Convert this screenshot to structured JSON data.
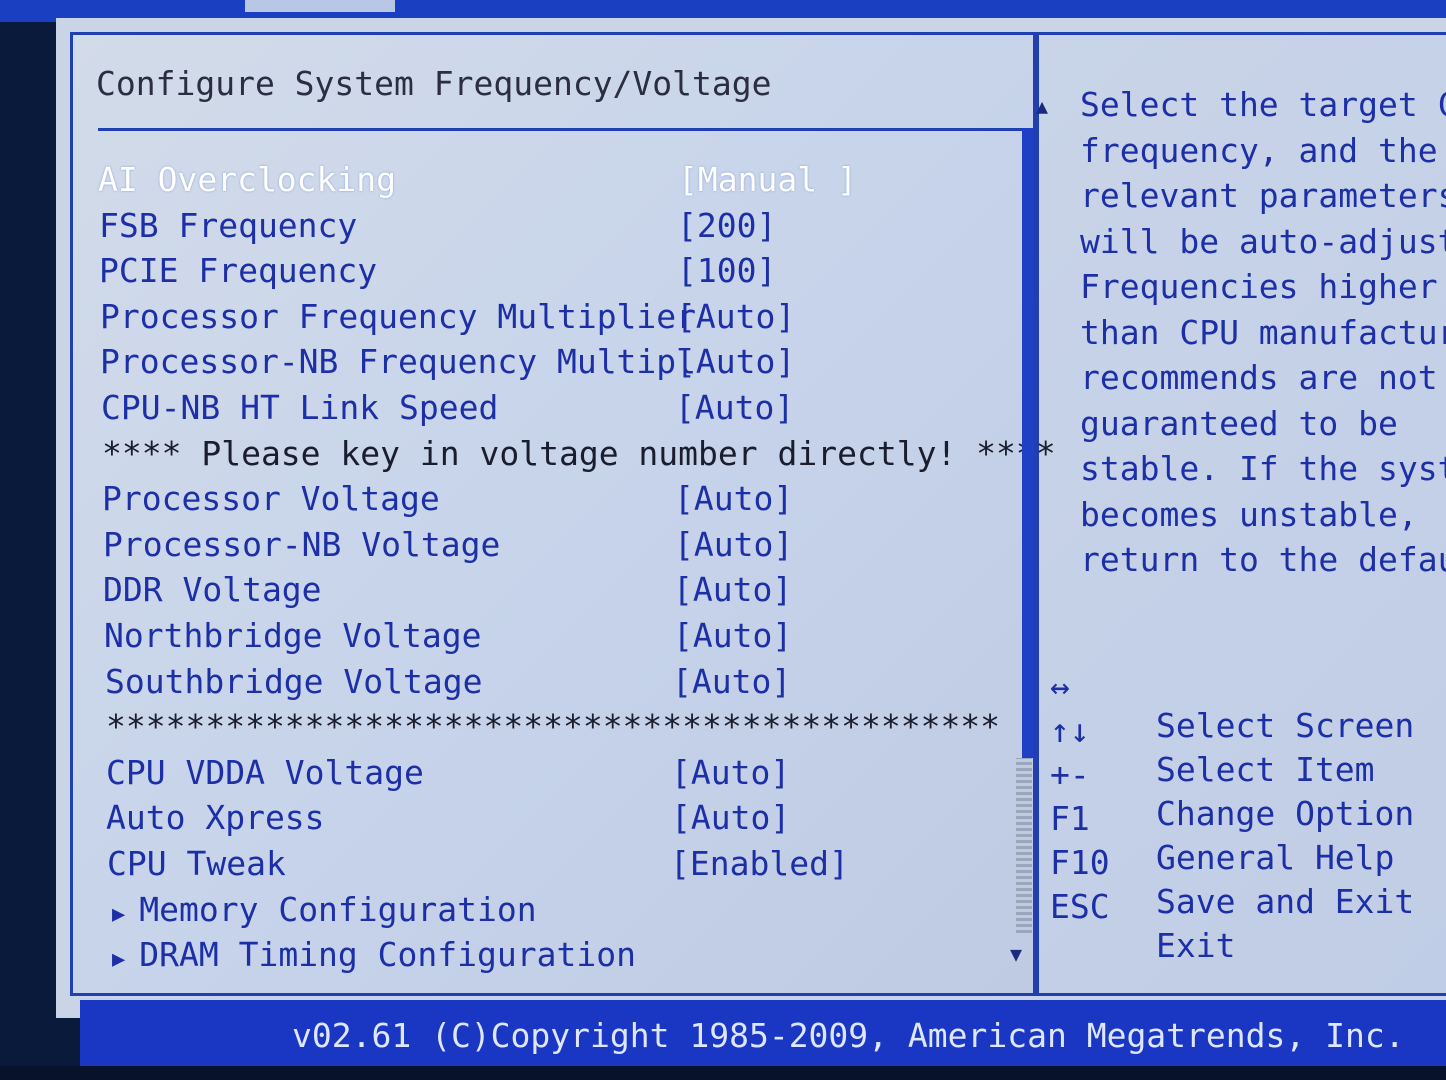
{
  "panel_title": "Configure System Frequency/Voltage",
  "settings": [
    {
      "label": "AI Overclocking",
      "value": "[Manual ]",
      "selected": true
    },
    {
      "label": "FSB Frequency",
      "value": "[200]"
    },
    {
      "label": "PCIE Frequency",
      "value": "[100]"
    },
    {
      "label": "Processor Frequency Multiplier",
      "value": "[Auto]"
    },
    {
      "label": "Processor-NB Frequency Multipl",
      "value": "[Auto]"
    },
    {
      "label": "CPU-NB HT Link Speed",
      "value": "[Auto]"
    },
    {
      "notice": "**** Please key in voltage number directly! ****"
    },
    {
      "label": "Processor Voltage",
      "value": "[Auto]"
    },
    {
      "label": "Processor-NB Voltage",
      "value": "[Auto]"
    },
    {
      "label": "DDR Voltage",
      "value": "[Auto]"
    },
    {
      "label": "Northbridge Voltage",
      "value": "[Auto]"
    },
    {
      "label": "Southbridge Voltage",
      "value": "[Auto]"
    },
    {
      "separator": "*********************************************"
    },
    {
      "label": "CPU VDDA Voltage",
      "value": "[Auto]"
    },
    {
      "label": "Auto Xpress",
      "value": "[Auto]"
    },
    {
      "label": "CPU Tweak",
      "value": "[Enabled]"
    },
    {
      "submenu": "Memory Configuration"
    },
    {
      "submenu": "DRAM Timing Configuration"
    }
  ],
  "submenu_arrow": "▶",
  "scroll_up": "▲",
  "scroll_down": "▼",
  "help_lines": [
    "Select the target CPU",
    "frequency, and the",
    "relevant parameters",
    "will be auto-adjusted",
    "Frequencies higher",
    "than CPU manufacturer",
    "recommends are not",
    "guaranteed to be",
    "stable. If the system",
    "becomes unstable,",
    "return to the default."
  ],
  "keys": [
    {
      "key": "↔",
      "desc": "Select Screen"
    },
    {
      "key": "↑↓",
      "desc": "Select Item"
    },
    {
      "key": "+-",
      "desc": "Change Option"
    },
    {
      "key": "F1",
      "desc": "General Help"
    },
    {
      "key": "F10",
      "desc": "Save and Exit"
    },
    {
      "key": "ESC",
      "desc": "Exit"
    }
  ],
  "footer": "v02.61 (C)Copyright 1985-2009, American Megatrends, Inc.",
  "colors": {
    "bios_blue": "#1c2fa6",
    "frame_blue": "#2040b0",
    "panel_bg": "#c9d4e6",
    "selected_text": "#ffffff"
  }
}
